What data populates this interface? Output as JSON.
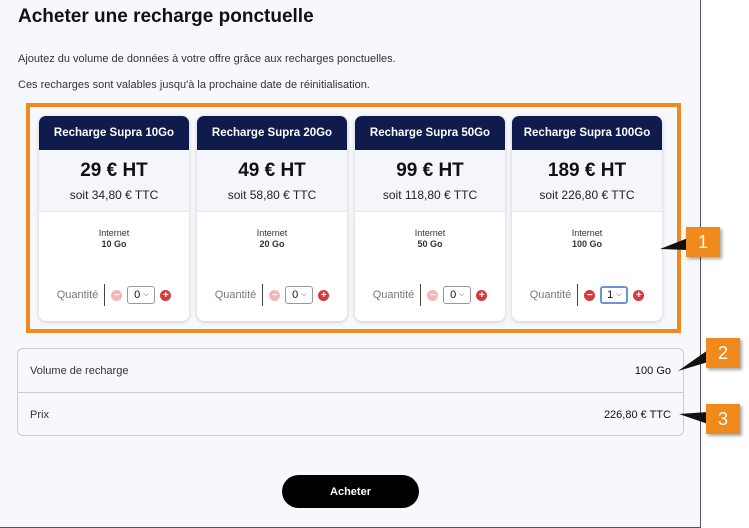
{
  "page": {
    "title": "Acheter une recharge ponctuelle",
    "description1": "Ajoutez du volume de données à votre offre grâce aux recharges ponctuelles.",
    "description2": "Ces recharges sont valables jusqu'à la prochaine date de réinitialisation."
  },
  "cards": [
    {
      "name": "Recharge Supra 10Go",
      "price_ht": "29 € HT",
      "price_ttc": "soit 34,80 € TTC",
      "info_label": "Internet",
      "info_value": "10 Go",
      "qty_label": "Quantité",
      "qty_value": "0"
    },
    {
      "name": "Recharge Supra 20Go",
      "price_ht": "49 € HT",
      "price_ttc": "soit 58,80 € TTC",
      "info_label": "Internet",
      "info_value": "20 Go",
      "qty_label": "Quantité",
      "qty_value": "0"
    },
    {
      "name": "Recharge Supra 50Go",
      "price_ht": "99 € HT",
      "price_ttc": "soit 118,80 € TTC",
      "info_label": "Internet",
      "info_value": "50 Go",
      "qty_label": "Quantité",
      "qty_value": "0"
    },
    {
      "name": "Recharge Supra 100Go",
      "price_ht": "189 € HT",
      "price_ttc": "soit 226,80 € TTC",
      "info_label": "Internet",
      "info_value": "100 Go",
      "qty_label": "Quantité",
      "qty_value": "1"
    }
  ],
  "summary": {
    "volume_label": "Volume de recharge",
    "volume_value": "100 Go",
    "price_label": "Prix",
    "price_value": "226,80 € TTC"
  },
  "actions": {
    "buy_label": "Acheter"
  },
  "callouts": [
    "1",
    "2",
    "3"
  ],
  "colors": {
    "header": "#0f1b4d",
    "accent": "#f08a1c",
    "minus": "#d63a3a",
    "button": "#000000"
  }
}
